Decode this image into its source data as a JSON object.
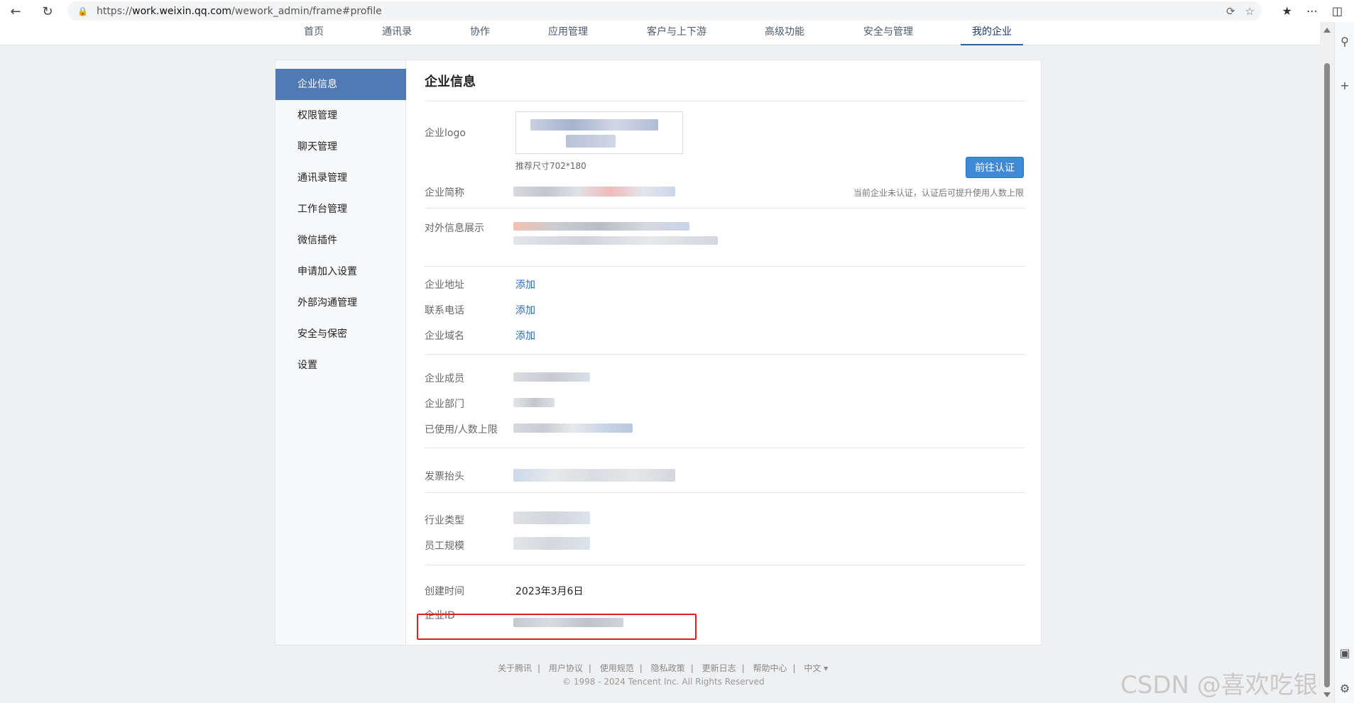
{
  "browser": {
    "url_prefix": "https://",
    "url_host": "work.weixin.qq.com",
    "url_path": "/wework_admin/frame#profile"
  },
  "topnav": {
    "items": [
      "首页",
      "通讯录",
      "协作",
      "应用管理",
      "客户与上下游",
      "高级功能",
      "安全与管理",
      "我的企业"
    ],
    "active_index": 7
  },
  "sidebar": {
    "items": [
      "企业信息",
      "权限管理",
      "聊天管理",
      "通讯录管理",
      "工作台管理",
      "微信插件",
      "申请加入设置",
      "外部沟通管理",
      "安全与保密",
      "设置"
    ],
    "active_index": 0
  },
  "content": {
    "title": "企业信息",
    "logo_label": "企业logo",
    "logo_hint": "推荐尺寸702*180",
    "verify_button": "前往认证",
    "verify_note": "当前企业未认证，认证后可提升使用人数上限",
    "short_name_label": "企业简称",
    "external_info_label": "对外信息展示",
    "address_label": "企业地址",
    "address_action": "添加",
    "phone_label": "联系电话",
    "phone_action": "添加",
    "domain_label": "企业域名",
    "domain_action": "添加",
    "members_label": "企业成员",
    "departments_label": "企业部门",
    "usage_label": "已使用/人数上限",
    "invoice_label": "发票抬头",
    "industry_label": "行业类型",
    "staff_size_label": "员工规模",
    "created_label": "创建时间",
    "created_value": "2023年3月6日",
    "corp_id_label": "企业ID"
  },
  "footer": {
    "links": [
      "关于腾讯",
      "用户协议",
      "使用规范",
      "隐私政策",
      "更新日志",
      "帮助中心",
      "中文 ▾"
    ],
    "separator": "|",
    "copyright": "© 1998 - 2024 Tencent Inc. All Rights Reserved"
  },
  "watermark": "CSDN @喜欢吃银帅",
  "colors": {
    "accent": "#4f7ab3",
    "link": "#2b6ab5",
    "button": "#3f8ad6",
    "highlight": "#e21d24"
  }
}
